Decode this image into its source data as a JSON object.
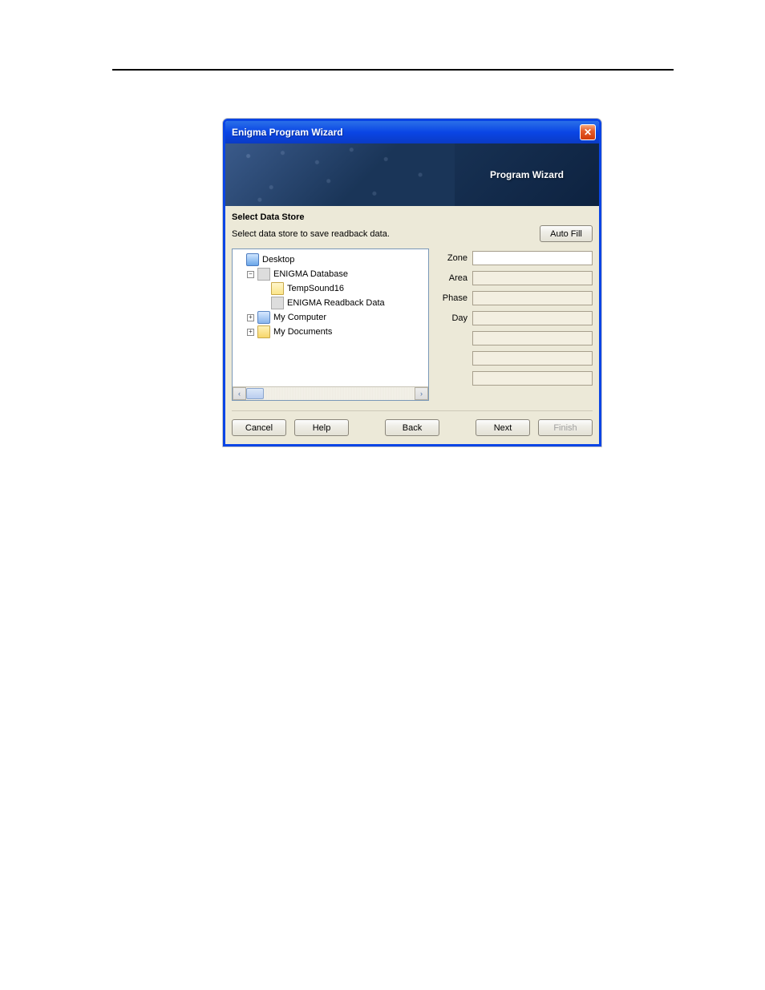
{
  "window": {
    "title": "Enigma Program Wizard",
    "banner_title": "Program Wizard"
  },
  "section": {
    "heading": "Select Data Store",
    "description": "Select data store to save readback data.",
    "autofill_label": "Auto Fill"
  },
  "tree": {
    "items": [
      {
        "label": "Desktop"
      },
      {
        "label": "ENIGMA Database"
      },
      {
        "label": "TempSound16"
      },
      {
        "label": "ENIGMA Readback Data"
      },
      {
        "label": "My Computer"
      },
      {
        "label": "My Documents"
      }
    ]
  },
  "fields": {
    "labels": {
      "zone": "Zone",
      "area": "Area",
      "phase": "Phase",
      "day": "Day"
    },
    "values": {
      "zone": "",
      "area": "",
      "phase": "",
      "day": "",
      "extra1": "",
      "extra2": "",
      "extra3": ""
    }
  },
  "buttons": {
    "cancel": "Cancel",
    "help": "Help",
    "back": "Back",
    "next": "Next",
    "finish": "Finish"
  },
  "expanders": {
    "plus": "+",
    "minus": "−"
  },
  "scroll": {
    "left": "‹",
    "right": "›"
  }
}
